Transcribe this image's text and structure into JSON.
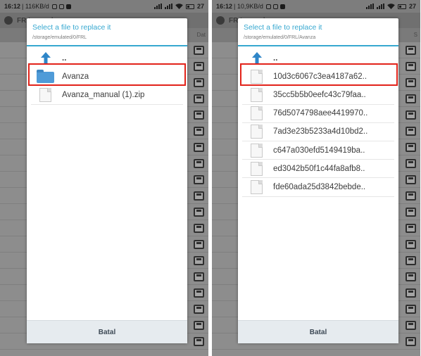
{
  "statusbar": {
    "left": {
      "time": "16:12",
      "speed": "| 116KB/d"
    },
    "right": {
      "time": "16:12",
      "speed": "| 10,9KB/d"
    },
    "battery": "27"
  },
  "app": {
    "title": "FR Legends",
    "subpath": "Dat",
    "subpath_right": "S"
  },
  "dialog_left": {
    "title": "Select a file to replace it",
    "path": "/storage/emulated/0/FRL",
    "up_label": "..",
    "items": [
      {
        "name": "Avanza",
        "type": "folder"
      },
      {
        "name": "Avanza_manual (1).zip",
        "type": "file"
      }
    ],
    "cancel_label": "Batal"
  },
  "dialog_right": {
    "title": "Select a file to replace it",
    "path": "/storage/emulated/0/FRL/Avanza",
    "up_label": "..",
    "items": [
      {
        "name": "10d3c6067c3ea4187a62..",
        "type": "file"
      },
      {
        "name": "35cc5b5b0eefc43c79faa..",
        "type": "file"
      },
      {
        "name": "76d5074798aee4419970..",
        "type": "file"
      },
      {
        "name": "7ad3e23b5233a4d10bd2..",
        "type": "file"
      },
      {
        "name": "c647a030efd5149419ba..",
        "type": "file"
      },
      {
        "name": "ed3042b50f1c44fa8afb8..",
        "type": "file"
      },
      {
        "name": "fde60ada25d3842bebde..",
        "type": "file"
      }
    ],
    "cancel_label": "Batal"
  },
  "colors": {
    "accent": "#37a8d0",
    "highlight": "#e2231a",
    "folder": "#4f9bd8"
  }
}
